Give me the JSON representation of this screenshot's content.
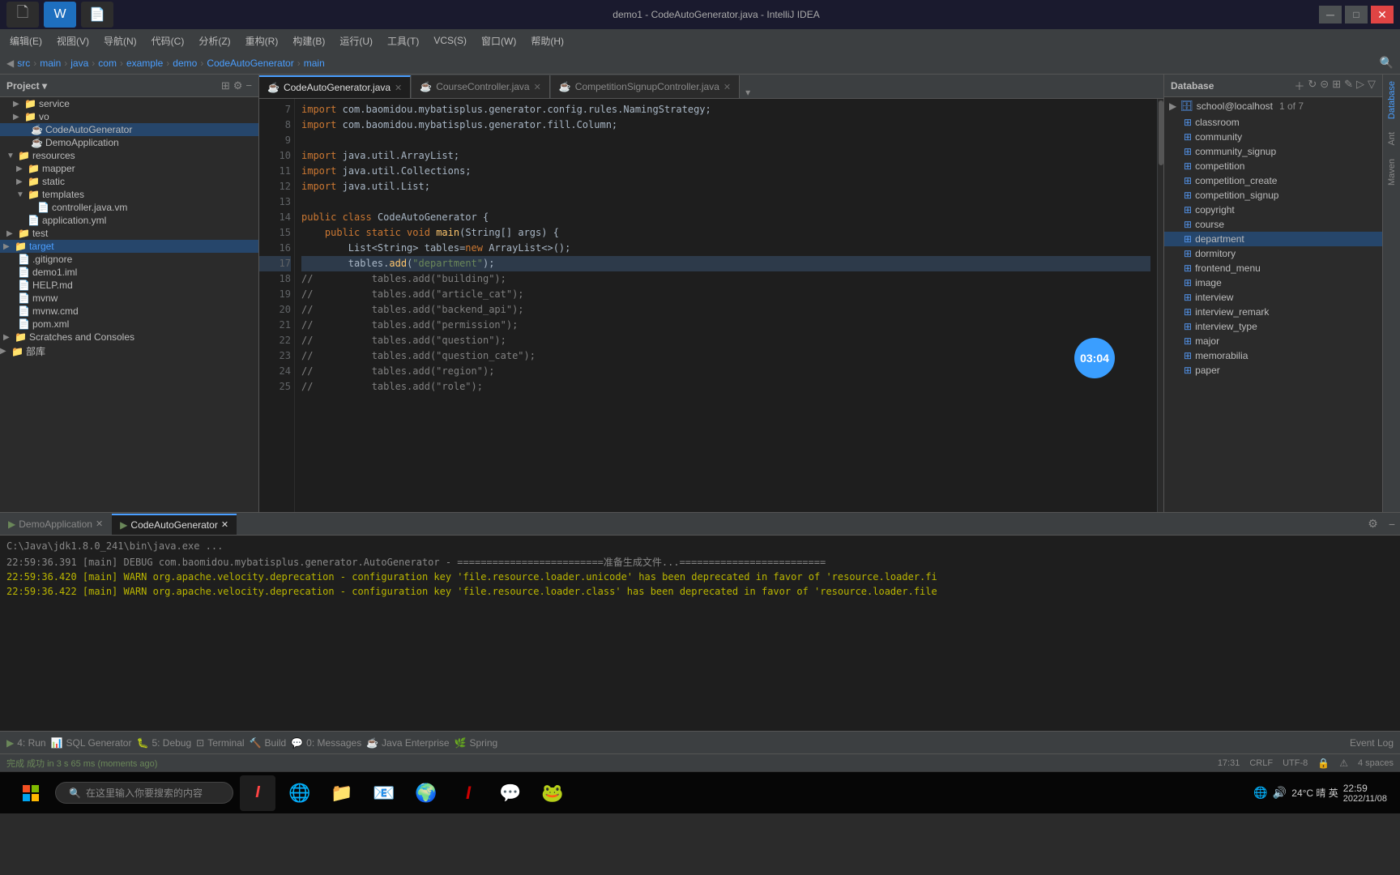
{
  "window": {
    "title": "demo1 - CodeAutoGenerator.java - IntelliJ IDEA",
    "breadcrumb": [
      "src",
      "main",
      "java",
      "com",
      "example",
      "demo",
      "CodeAutoGenerator",
      "main"
    ]
  },
  "menu": {
    "items": [
      "编辑(E)",
      "视图(V)",
      "导航(N)",
      "代码(C)",
      "分析(Z)",
      "重构(R)",
      "构建(B)",
      "运行(U)",
      "工具(T)",
      "VCS(S)",
      "窗口(W)",
      "帮助(H)"
    ]
  },
  "editor_tabs": [
    {
      "label": "CodeAutoGenerator.java",
      "active": true,
      "closeable": true
    },
    {
      "label": "CourseController.java",
      "active": false,
      "closeable": true
    },
    {
      "label": "CompetitionSignupController.java",
      "active": false,
      "closeable": true
    }
  ],
  "code_lines": [
    {
      "num": 7,
      "content": "import com.baomidou.mybatisplus.generator.config.rules.NamingStrategy;"
    },
    {
      "num": 8,
      "content": "import com.baomidou.mybatisplus.generator.fill.Column;"
    },
    {
      "num": 9,
      "content": ""
    },
    {
      "num": 10,
      "content": "import java.util.ArrayList;"
    },
    {
      "num": 11,
      "content": "import java.util.Collections;"
    },
    {
      "num": 12,
      "content": "import java.util.List;"
    },
    {
      "num": 13,
      "content": ""
    },
    {
      "num": 14,
      "content": "public class CodeAutoGenerator {"
    },
    {
      "num": 15,
      "content": "    public static void main(String[] args) {"
    },
    {
      "num": 16,
      "content": "        List<String> tables=new ArrayList<>();"
    },
    {
      "num": 17,
      "content": "        tables.add(\"department\");",
      "highlight": true
    },
    {
      "num": 18,
      "content": "//          tables.add(\"building\");"
    },
    {
      "num": 19,
      "content": "//          tables.add(\"article_cat\");"
    },
    {
      "num": 20,
      "content": "//          tables.add(\"backend_api\");"
    },
    {
      "num": 21,
      "content": "//          tables.add(\"permission\");"
    },
    {
      "num": 22,
      "content": "//          tables.add(\"question\");"
    },
    {
      "num": 23,
      "content": "//          tables.add(\"question_cate\");"
    },
    {
      "num": 24,
      "content": "//          tables.add(\"region\");"
    },
    {
      "num": 25,
      "content": "//          tables.add(\"role\");"
    }
  ],
  "timer": {
    "value": "03:04"
  },
  "project_tree": {
    "items": [
      {
        "label": "service",
        "type": "folder",
        "indent": 16,
        "expanded": false
      },
      {
        "label": "vo",
        "type": "folder",
        "indent": 16,
        "expanded": false
      },
      {
        "label": "CodeAutoGenerator",
        "type": "java",
        "indent": 24,
        "selected": true
      },
      {
        "label": "DemoApplication",
        "type": "java",
        "indent": 24,
        "selected": false
      },
      {
        "label": "resources",
        "type": "folder",
        "indent": 8,
        "expanded": true
      },
      {
        "label": "mapper",
        "type": "folder",
        "indent": 16,
        "expanded": false
      },
      {
        "label": "static",
        "type": "folder",
        "indent": 16,
        "expanded": false
      },
      {
        "label": "templates",
        "type": "folder",
        "indent": 16,
        "expanded": false
      },
      {
        "label": "controller.java.vm",
        "type": "file",
        "indent": 24
      },
      {
        "label": "application.yml",
        "type": "file",
        "indent": 16
      },
      {
        "label": "test",
        "type": "folder",
        "indent": 8,
        "expanded": false
      },
      {
        "label": "target",
        "type": "folder",
        "indent": 4,
        "expanded": false,
        "selected": true
      },
      {
        "label": ".gitignore",
        "type": "file",
        "indent": 4
      },
      {
        "label": "demo1.iml",
        "type": "file",
        "indent": 4
      },
      {
        "label": "HELP.md",
        "type": "file",
        "indent": 4
      },
      {
        "label": "mvnw",
        "type": "file",
        "indent": 4
      },
      {
        "label": "mvnw.cmd",
        "type": "file",
        "indent": 4
      },
      {
        "label": "pom.xml",
        "type": "file",
        "indent": 4
      },
      {
        "label": "Scratches and Consoles",
        "type": "folder",
        "indent": 0
      },
      {
        "label": "部库",
        "type": "folder",
        "indent": 0
      }
    ]
  },
  "database_panel": {
    "title": "Database",
    "connection": "school@localhost",
    "connection_info": "1 of 7",
    "tables": [
      {
        "name": "classroom",
        "selected": false
      },
      {
        "name": "community",
        "selected": false
      },
      {
        "name": "community_signup",
        "selected": false
      },
      {
        "name": "competition",
        "selected": false
      },
      {
        "name": "competition_create",
        "selected": false
      },
      {
        "name": "competition_signup",
        "selected": false
      },
      {
        "name": "copyright",
        "selected": false
      },
      {
        "name": "course",
        "selected": false
      },
      {
        "name": "department",
        "selected": true
      },
      {
        "name": "dormitory",
        "selected": false
      },
      {
        "name": "frontend_menu",
        "selected": false
      },
      {
        "name": "image",
        "selected": false
      },
      {
        "name": "interview",
        "selected": false
      },
      {
        "name": "interview_remark",
        "selected": false
      },
      {
        "name": "interview_type",
        "selected": false
      },
      {
        "name": "major",
        "selected": false
      },
      {
        "name": "memorabilia",
        "selected": false
      },
      {
        "name": "paper",
        "selected": false
      }
    ]
  },
  "bottom_panel": {
    "tabs": [
      {
        "label": "DemoApplication",
        "closeable": true,
        "active": false
      },
      {
        "label": "CodeAutoGenerator",
        "closeable": true,
        "active": true
      }
    ],
    "path": "C:\\Java\\jdk1.8.0_241\\bin\\java.exe ...",
    "log_lines": [
      {
        "text": "22:59:36.391 [main] DEBUG com.baomidou.mybatisplus.generator.AutoGenerator - =========================准备生成文件...========================="
      },
      {
        "text": "22:59:36.420 [main] WARN org.apache.velocity.deprecation - configuration key 'file.resource.loader.unicode' has been deprecated in favor of 'resource.loader.fi"
      },
      {
        "text": "22:59:36.422 [main] WARN org.apache.velocity.deprecation - configuration key 'file.resource.loader.class' has been deprecated in favor of 'resource.loader.file"
      }
    ]
  },
  "bottom_controls": {
    "items": [
      {
        "label": "4: Run",
        "icon": "▶"
      },
      {
        "label": "SQL Generator"
      },
      {
        "label": "5: Debug"
      },
      {
        "label": "Terminal"
      },
      {
        "label": "Build"
      },
      {
        "label": "0: Messages"
      },
      {
        "label": "Java Enterprise"
      },
      {
        "label": "Spring"
      }
    ],
    "right": {
      "label": "Event Log"
    }
  },
  "status_bar": {
    "left": "完成 成功 in 3 s 65 ms (moments ago)",
    "position": "17:31",
    "encoding": "CRLF",
    "charset": "UTF-8",
    "indent_type": "4 spaces"
  },
  "win_taskbar": {
    "search_placeholder": "在这里输入你要搜索的内容",
    "time": "22:59",
    "date": "2022/11/08",
    "temp": "24°C  晴  英"
  }
}
